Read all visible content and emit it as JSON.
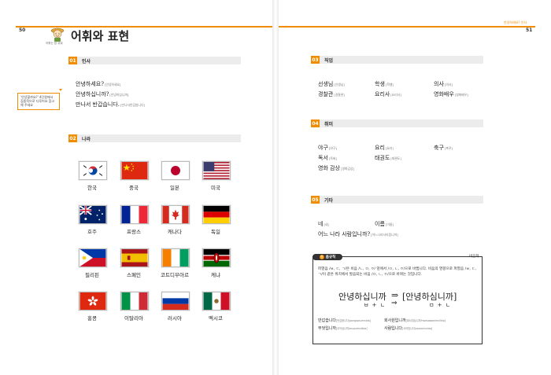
{
  "header": {
    "left_page_number": "50",
    "right_page_number": "51",
    "title": "어휘와 표현",
    "right_running_head": "안녕하세요? 인사",
    "mascot_caption": "어휘는 참 쉬워",
    "accent_color": "#f08c00"
  },
  "side_note": "'안녕할까요?' 4단원에서 집중적으로 다루어요 참고해 주세요",
  "sections": {
    "greeting": {
      "num": "01",
      "label": "인사",
      "items": [
        {
          "word": "안녕하세요?",
          "pron": "[안녕하세요]"
        },
        {
          "word": "안녕하십니까?",
          "pron": "[안녕하심니까]"
        },
        {
          "word": "만나서 반갑습니다.",
          "pron": "[만나서반갑씀니다]"
        }
      ]
    },
    "country": {
      "num": "02",
      "label": "나라",
      "items": [
        {
          "name": "한국",
          "flag": "korea-flag-icon"
        },
        {
          "name": "중국",
          "flag": "china-flag-icon"
        },
        {
          "name": "일본",
          "flag": "japan-flag-icon"
        },
        {
          "name": "미국",
          "flag": "usa-flag-icon"
        },
        {
          "name": "호주",
          "flag": "australia-flag-icon"
        },
        {
          "name": "프랑스",
          "flag": "france-flag-icon"
        },
        {
          "name": "캐나다",
          "flag": "canada-flag-icon"
        },
        {
          "name": "독일",
          "flag": "germany-flag-icon"
        },
        {
          "name": "필리핀",
          "flag": "philippines-flag-icon"
        },
        {
          "name": "스페인",
          "flag": "spain-flag-icon"
        },
        {
          "name": "코트디부아르",
          "flag": "ivory-coast-flag-icon"
        },
        {
          "name": "케냐",
          "flag": "kenya-flag-icon"
        },
        {
          "name": "홍콩",
          "flag": "hong-kong-flag-icon"
        },
        {
          "name": "이탈리아",
          "flag": "italy-flag-icon"
        },
        {
          "name": "러시아",
          "flag": "russia-flag-icon"
        },
        {
          "name": "멕시코",
          "flag": "mexico-flag-icon"
        }
      ]
    },
    "job": {
      "num": "03",
      "label": "직업",
      "items": [
        {
          "word": "선생님",
          "pron": "[선생님]"
        },
        {
          "word": "학생",
          "pron": "[학쌩]"
        },
        {
          "word": "의사",
          "pron": "[의사]"
        },
        {
          "word": "경찰관",
          "pron": "[경찰관]"
        },
        {
          "word": "요리사",
          "pron": "[요리사]"
        },
        {
          "word": "영화배우",
          "pron": "[영화배우]"
        }
      ]
    },
    "hobby": {
      "num": "04",
      "label": "취미",
      "items": [
        {
          "word": "야구",
          "pron": "[야구]"
        },
        {
          "word": "요리",
          "pron": "[요리]"
        },
        {
          "word": "축구",
          "pron": "[축꾸]"
        },
        {
          "word": "독서",
          "pron": "[독써]"
        },
        {
          "word": "태권도",
          "pron": "[태꿘도]"
        },
        {
          "word": "영화 감상",
          "pron": "[영화감상]"
        }
      ]
    },
    "other": {
      "num": "05",
      "label": "기타",
      "items": [
        {
          "word": "네",
          "pron": "[네]"
        },
        {
          "word": "이름",
          "pron": "[이름]"
        },
        {
          "word": "어느 나라 사람입니까?",
          "pron": "[어느나라사라밈니까]"
        }
      ]
    }
  },
  "pronunciation": {
    "tag_num": "발",
    "tag_label": "음규칙",
    "rule_name": "비음화",
    "description": "파열음 /ㅂ, ㄷ, ㄱ/은 비음 /ㄴ, ㅁ, ㅇ/ 앞에서 /ㅁ, ㄴ, ㅇ/으로 바뀝니다. 비음의 영향으로 파열음 /ㅂ, ㄷ, ㄱ/이 같은 위치에서 발음되는 비음 /ㅁ, ㄴ, ㅇ/으로 바뀌는 것입니다.",
    "example_left": "안녕하십니까",
    "arrow": "⇒",
    "example_right": "[안녕하심니까]",
    "decomp_left": "ㅂ + ㄴ",
    "decomp_right": "ㅁ + ㄴ",
    "examples": [
      {
        "word": "반갑습니다",
        "pron": "[반갑씀니다/pangapsumnida]"
      },
      {
        "word": "회사원입니까",
        "pron": "[회사워님니까/hwesawonimnikka]"
      },
      {
        "word": "무엇입니까",
        "pron": "[무어심니까/muosimnikka]"
      },
      {
        "word": "사람입니다",
        "pron": "[사라밈니다/saraminnida]"
      }
    ]
  }
}
